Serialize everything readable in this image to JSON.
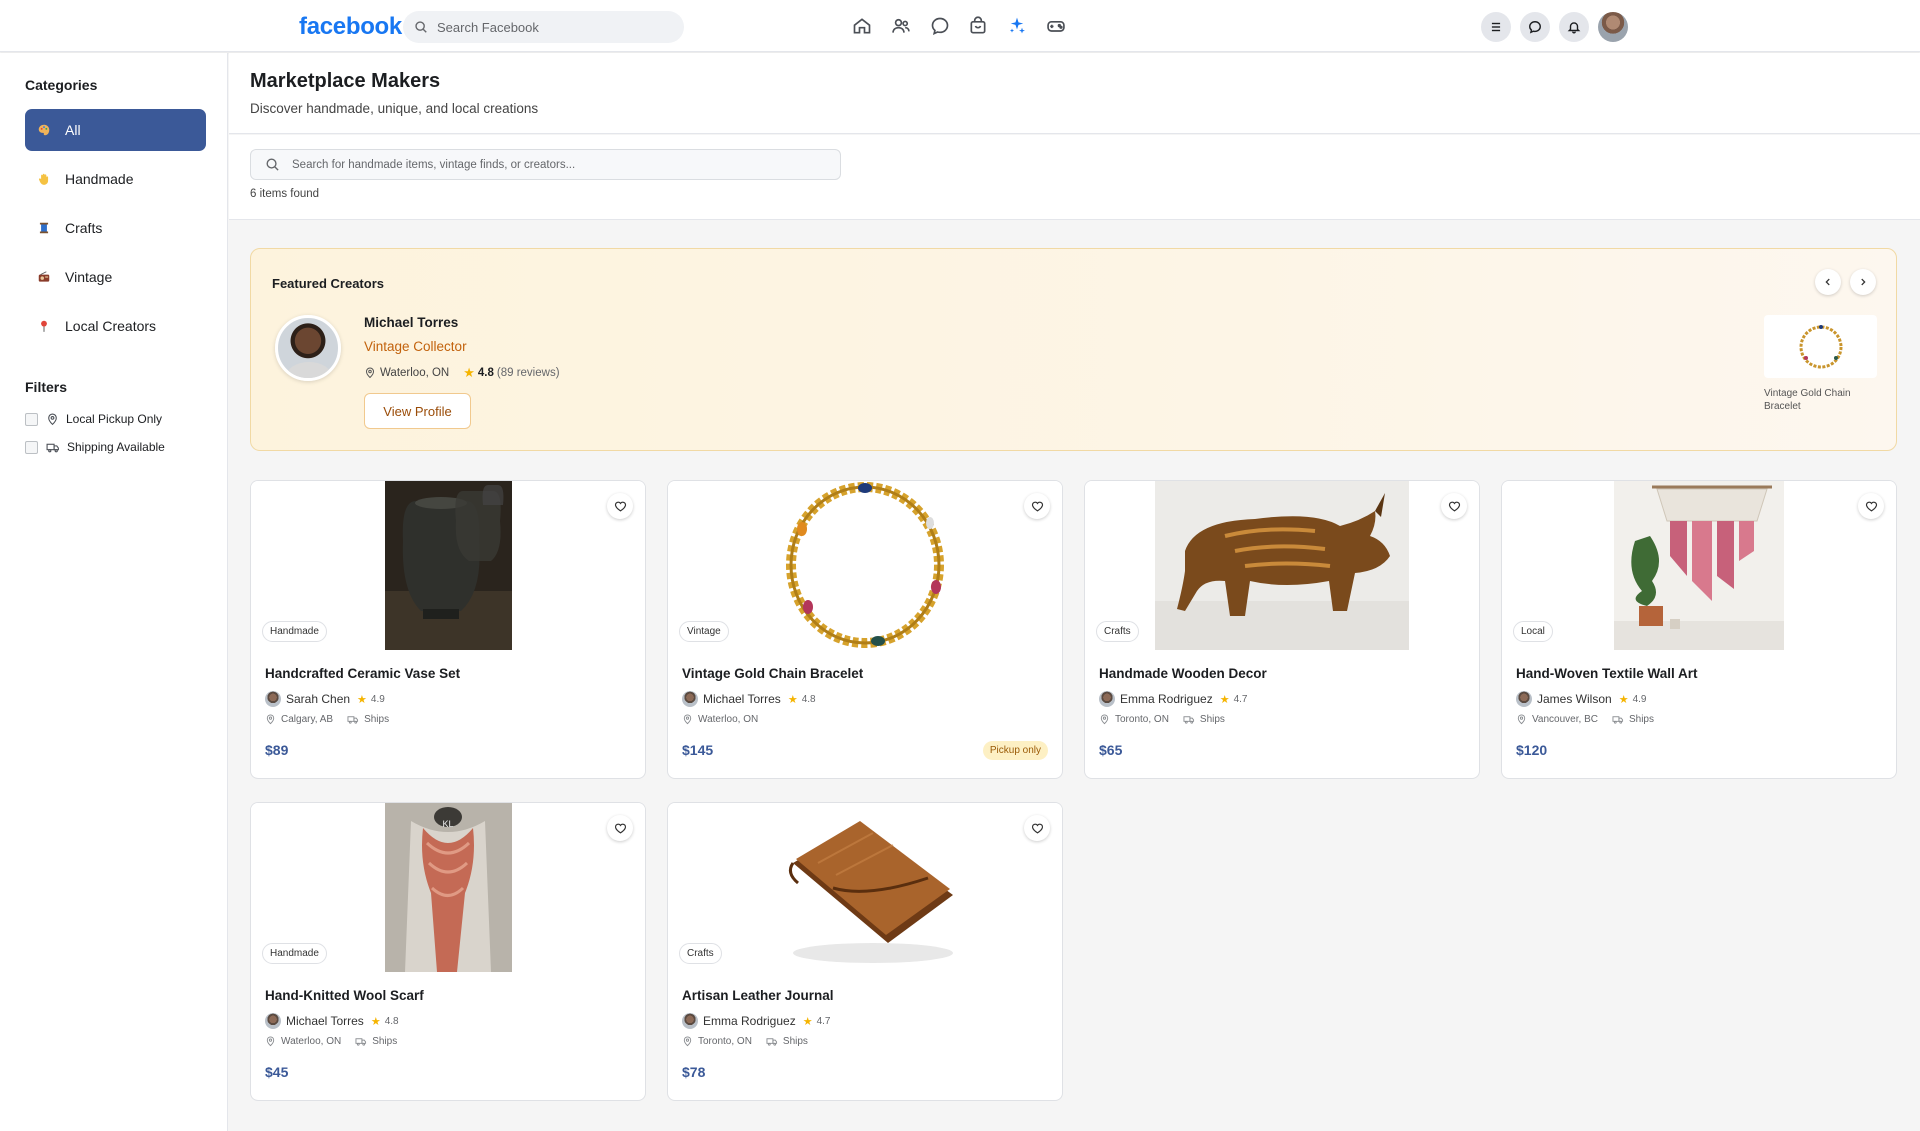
{
  "topbar": {
    "logo": "facebook",
    "search_placeholder": "Search Facebook",
    "nav_icons": [
      "home-icon",
      "friends-icon",
      "messenger-icon",
      "marketplace-icon",
      "sparkle-icon",
      "gaming-icon"
    ],
    "right_icons": [
      "menu-icon",
      "chat-icon",
      "bell-icon"
    ],
    "brand_color": "#1877f2"
  },
  "sidebar": {
    "categories_heading": "Categories",
    "categories": [
      {
        "label": "All",
        "icon": "palette-icon",
        "active": true
      },
      {
        "label": "Handmade",
        "icon": "hand-icon",
        "active": false
      },
      {
        "label": "Crafts",
        "icon": "thread-spool-icon",
        "active": false
      },
      {
        "label": "Vintage",
        "icon": "radio-icon",
        "active": false
      },
      {
        "label": "Local Creators",
        "icon": "pin-icon",
        "active": false
      }
    ],
    "filters_heading": "Filters",
    "filters": [
      {
        "label": "Local Pickup Only",
        "icon": "location-icon",
        "checked": false
      },
      {
        "label": "Shipping Available",
        "icon": "truck-icon",
        "checked": false
      }
    ],
    "accent_color": "#3b5998"
  },
  "main": {
    "title": "Marketplace Makers",
    "subtitle": "Discover handmade, unique, and local creations",
    "search_placeholder": "Search for handmade items, vintage finds, or creators...",
    "results_count": "6 items found"
  },
  "featured": {
    "heading": "Featured Creators",
    "creator": {
      "name": "Michael Torres",
      "role": "Vintage Collector",
      "location": "Waterloo, ON",
      "rating": "4.8",
      "reviews": "(89 reviews)",
      "button": "View Profile"
    },
    "thumb_label": "Vintage Gold Chain Bracelet"
  },
  "products": [
    {
      "title": "Handcrafted Ceramic Vase Set",
      "tag": "Handmade",
      "seller": "Sarah Chen",
      "rating": "4.9",
      "location": "Calgary, AB",
      "shipping": "Ships",
      "price": "$89",
      "pickup": "",
      "image": "ceramic-vase"
    },
    {
      "title": "Vintage Gold Chain Bracelet",
      "tag": "Vintage",
      "seller": "Michael Torres",
      "rating": "4.8",
      "location": "Waterloo, ON",
      "shipping": "",
      "price": "$145",
      "pickup": "Pickup only",
      "image": "gold-bracelet"
    },
    {
      "title": "Handmade Wooden Decor",
      "tag": "Crafts",
      "seller": "Emma Rodriguez",
      "rating": "4.7",
      "location": "Toronto, ON",
      "shipping": "Ships",
      "price": "$65",
      "pickup": "",
      "image": "wooden-rhino"
    },
    {
      "title": "Hand-Woven Textile Wall Art",
      "tag": "Local",
      "seller": "James Wilson",
      "rating": "4.9",
      "location": "Vancouver, BC",
      "shipping": "Ships",
      "price": "$120",
      "pickup": "",
      "image": "macrame-wall-art"
    },
    {
      "title": "Hand-Knitted Wool Scarf",
      "tag": "Handmade",
      "seller": "Michael Torres",
      "rating": "4.8",
      "location": "Waterloo, ON",
      "shipping": "Ships",
      "price": "$45",
      "pickup": "",
      "image": "wool-scarf"
    },
    {
      "title": "Artisan Leather Journal",
      "tag": "Crafts",
      "seller": "Emma Rodriguez",
      "rating": "4.7",
      "location": "Toronto, ON",
      "shipping": "Ships",
      "price": "$78",
      "pickup": "",
      "image": "leather-journal"
    }
  ]
}
